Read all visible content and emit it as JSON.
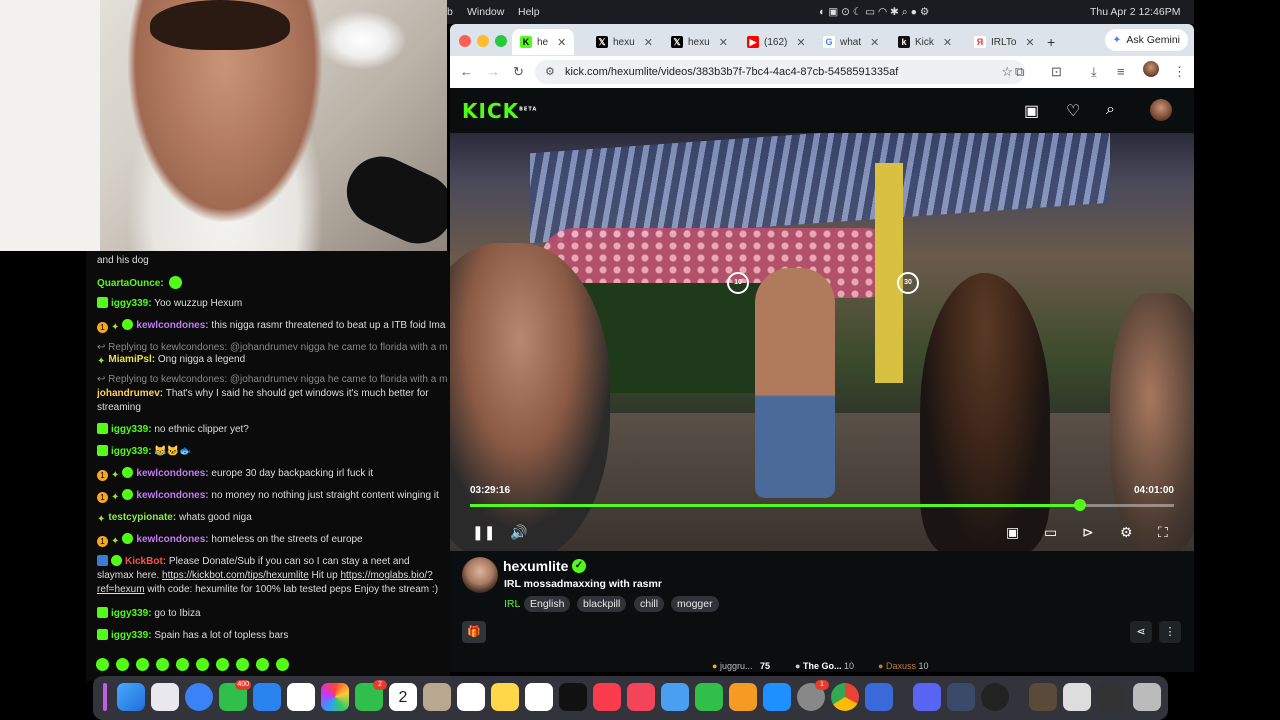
{
  "menubar": {
    "app_fragment": "b",
    "window": "Window",
    "help": "Help",
    "datetime": "Thu Apr 2  12:46PM"
  },
  "chat": {
    "lines": [
      {
        "text": "and his dog"
      },
      {
        "user": "QuartaOunce:",
        "text": ""
      },
      {
        "user": "iggy339:",
        "text": "Yoo wuzzup Hexum"
      },
      {
        "user": "kewlcondones:",
        "text": "this nigga rasmr threatened to beat up a ITB foid Ima"
      },
      {
        "reply": "Replying to kewlcondones: @johandrumev nigga he came to florida with a macbo"
      },
      {
        "user": "MiamiPsl:",
        "text": "Ong nigga a legend"
      },
      {
        "reply": "Replying to kewlcondones: @johandrumev nigga he came to florida with a macbo"
      },
      {
        "user": "johandrumev:",
        "text": "That's why I said he should get windows it's much better for streaming"
      },
      {
        "user": "iggy339:",
        "text": "no ethnic clipper yet?"
      },
      {
        "user": "iggy339:",
        "text": ""
      },
      {
        "user": "kewlcondones:",
        "text": "europe 30 day backpacking irl fuck it"
      },
      {
        "user": "kewlcondones:",
        "text": "no money no nothing just straight content winging it"
      },
      {
        "user": "testcypionate:",
        "text": "whats good niga"
      },
      {
        "user": "kewlcondones:",
        "text": "homeless on the streets of europe"
      },
      {
        "user": "KickBot:",
        "text": "Please Donate/Sub if you can so I can stay a neet and slaymax here.",
        "link1": "https://kickbot.com/tips/hexumlite",
        "mid": "Hit up",
        "link2": "https://moglabs.bio/?ref=hexum",
        "tail": "with code: hexumlite for 100% lab tested peps Enjoy the stream :)"
      },
      {
        "user": "iggy339:",
        "text": "go to Ibiza"
      },
      {
        "user": "iggy339:",
        "text": "Spain has a lot of topless bars"
      }
    ],
    "colors": {
      "iggy": "#53fc18",
      "kewl": "#c27cf0",
      "quarta": "#53fc18",
      "miami": "#e8e04a",
      "johan": "#ffcf5a",
      "testcyp": "#8ee84a",
      "kickbot": "#ff4d4d"
    }
  },
  "browser": {
    "tabs": [
      {
        "label": "he",
        "icon": "kick-icon"
      },
      {
        "label": "hexu",
        "icon": "x-icon"
      },
      {
        "label": "hexu",
        "icon": "x-icon"
      },
      {
        "label": "(162)",
        "icon": "youtube-icon"
      },
      {
        "label": "what",
        "icon": "google-icon"
      },
      {
        "label": "Kick",
        "icon": "kick-icon"
      },
      {
        "label": "IRLTo",
        "icon": "yandex-icon"
      }
    ],
    "new_tab": "+",
    "gemini": "Ask Gemini",
    "url": "kick.com/hexumlite/videos/383b3b7f-7bc4-4ac4-87cb-5458591335af"
  },
  "kick": {
    "logo": "KICK",
    "beta": "BETA",
    "video": {
      "current_time": "03:29:16",
      "duration": "04:01:00",
      "progress": 0.867,
      "skip_back": "10",
      "skip_fwd": "30"
    },
    "streamer": "hexumlite",
    "title": "IRL mossadmaxxing with rasmr",
    "category": "IRL",
    "tags": [
      "English",
      "blackpill",
      "chill",
      "mogger"
    ],
    "leaderboard": [
      {
        "name": "juggru...",
        "value": "75"
      },
      {
        "name": "The Go...",
        "value": "10"
      },
      {
        "name": "Daxuss",
        "value": "10"
      }
    ]
  },
  "dock": {
    "badges": {
      "mail": "400",
      "messages": "2",
      "settings": "1"
    },
    "calendar_day": "2",
    "calendar_month": "APR"
  }
}
